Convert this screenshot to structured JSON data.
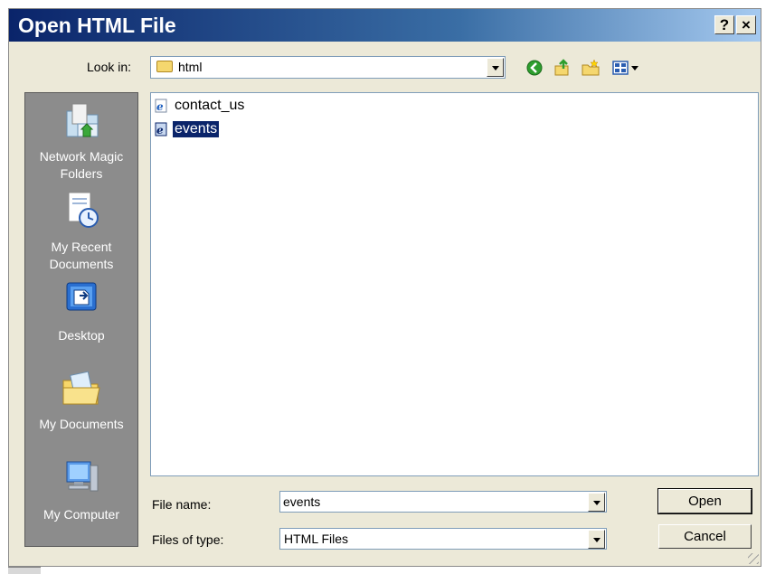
{
  "window": {
    "title": "Open HTML File",
    "help_label": "?",
    "close_label": "×"
  },
  "toolbar": {
    "lookin_label": "Look in:",
    "lookin_value": "html",
    "icons": [
      "back-icon",
      "up-folder-icon",
      "new-folder-icon",
      "view-menu-icon"
    ]
  },
  "places": [
    {
      "label": "Network Magic Folders",
      "icon": "network-folder-icon"
    },
    {
      "label": "My Recent Documents",
      "icon": "recent-documents-icon"
    },
    {
      "label": "Desktop",
      "icon": "desktop-icon"
    },
    {
      "label": "My Documents",
      "icon": "my-documents-icon"
    },
    {
      "label": "My Computer",
      "icon": "my-computer-icon"
    }
  ],
  "files": [
    {
      "name": "contact_us",
      "icon": "html-file-icon",
      "selected": false
    },
    {
      "name": "events",
      "icon": "html-file-icon",
      "selected": true
    }
  ],
  "form": {
    "file_name_label": "File name:",
    "file_name_value": "events",
    "file_type_label": "Files of type:",
    "file_type_value": "HTML Files"
  },
  "buttons": {
    "open": "Open",
    "cancel": "Cancel"
  },
  "colors": {
    "title_bar": "#0a246a",
    "dialog_bg": "#ece9d8",
    "places_bar": "#8c8c8c",
    "selection": "#0a246a"
  }
}
